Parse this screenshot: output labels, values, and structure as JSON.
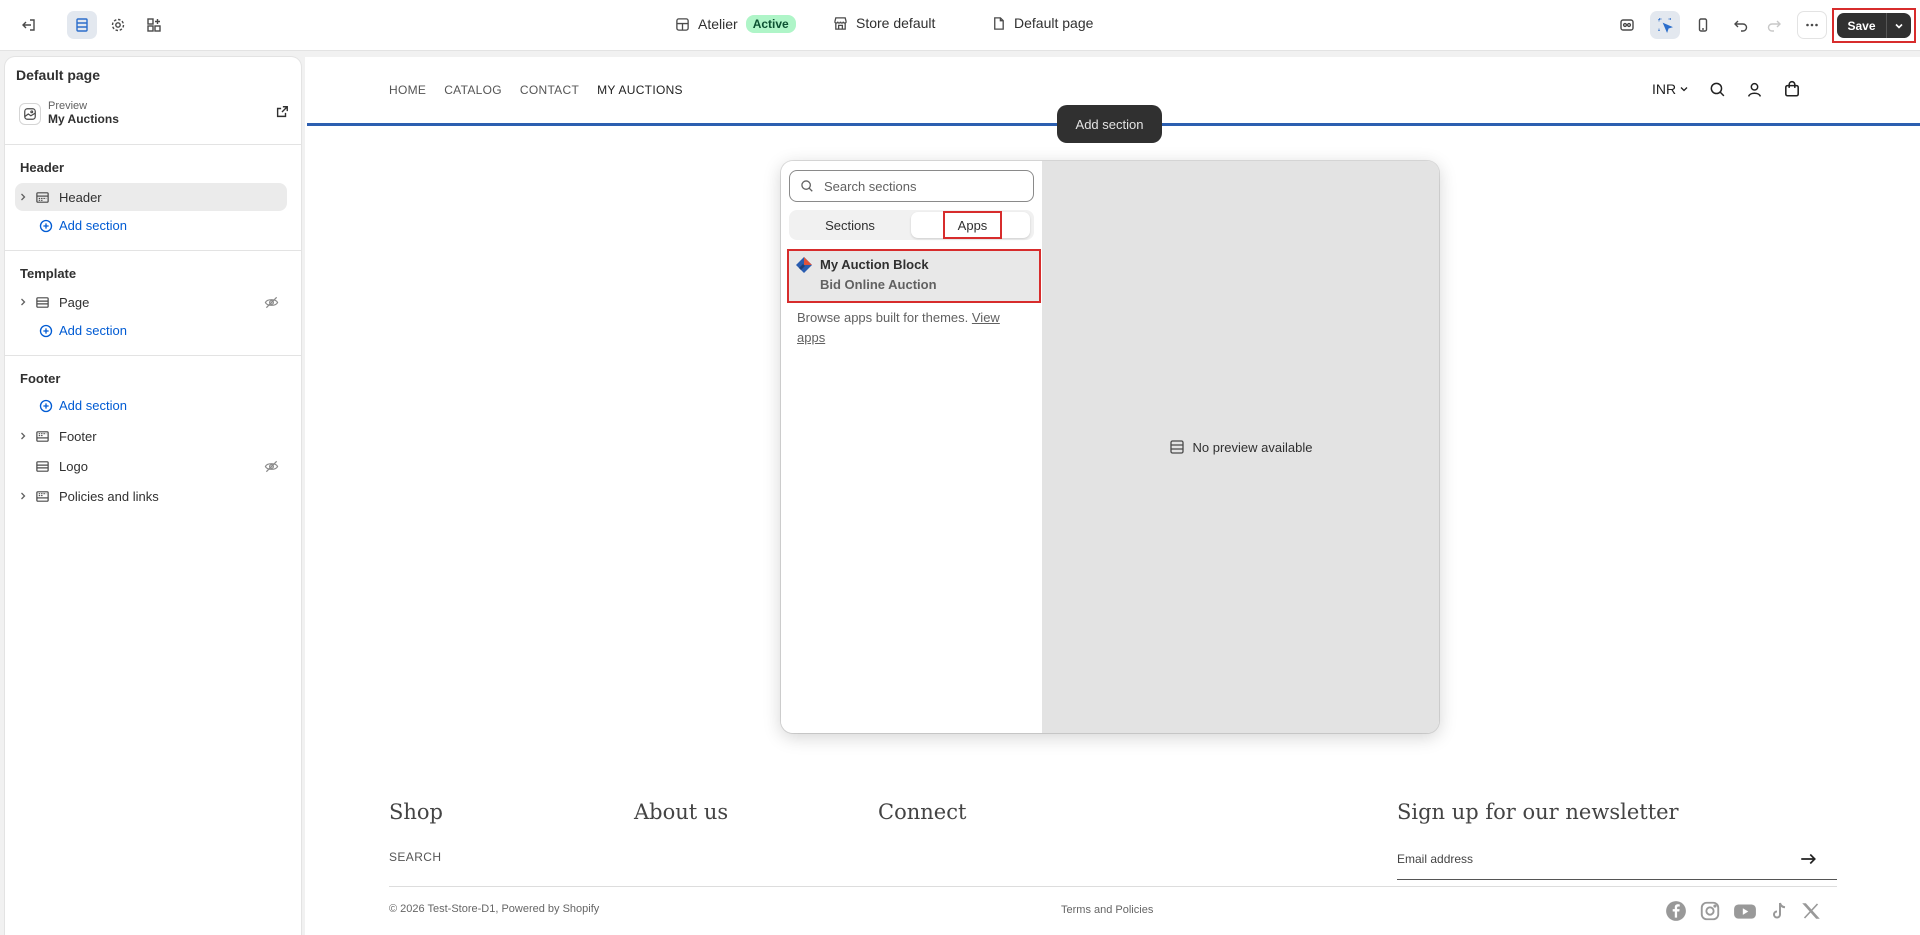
{
  "topbar": {
    "theme_name": "Atelier",
    "theme_status": "Active",
    "store": "Store default",
    "page": "Default page",
    "save_label": "Save"
  },
  "sidebar": {
    "title": "Default page",
    "preview_label": "Preview",
    "preview_value": "My Auctions",
    "groups": {
      "header": {
        "title": "Header",
        "items": [
          "Header"
        ],
        "add": "Add section"
      },
      "template": {
        "title": "Template",
        "items": [
          "Page"
        ],
        "add": "Add section"
      },
      "footer": {
        "title": "Footer",
        "add": "Add section",
        "items": [
          "Footer",
          "Logo",
          "Policies and links"
        ]
      }
    }
  },
  "store_nav": {
    "items": [
      "HOME",
      "CATALOG",
      "CONTACT",
      "MY AUCTIONS"
    ],
    "currency": "INR"
  },
  "add_section_tooltip": "Add section",
  "modal": {
    "search_placeholder": "Search sections",
    "tabs": [
      "Sections",
      "Apps"
    ],
    "app": {
      "name": "My Auction Block",
      "subtitle": "Bid Online Auction"
    },
    "browse_text": "Browse apps built for themes.",
    "browse_link": "View apps",
    "preview_empty": "No preview available"
  },
  "store_footer": {
    "headings": [
      "Shop",
      "About us",
      "Connect",
      "Sign up for our newsletter"
    ],
    "search_link": "SEARCH",
    "email_placeholder": "Email address",
    "copyright": "© 2026 Test-Store-D1, Powered by Shopify",
    "terms": "Terms and Policies"
  },
  "icons": [
    "exit-icon",
    "sections-icon",
    "settings-icon",
    "apps-icon",
    "layout-icon",
    "store-icon",
    "page-icon",
    "eye-icon",
    "selector-icon",
    "mobile-icon",
    "undo-icon",
    "redo-icon",
    "more-icon",
    "chevron-down-icon",
    "search-icon",
    "user-icon",
    "cart-icon",
    "facebook-icon",
    "instagram-icon",
    "youtube-icon",
    "tiktok-icon",
    "x-icon"
  ],
  "colors": {
    "accent": "#005bd3",
    "active_badge": "#aff5c8",
    "highlight": "#d72c2c",
    "store_bar": "#2c5fb0"
  }
}
